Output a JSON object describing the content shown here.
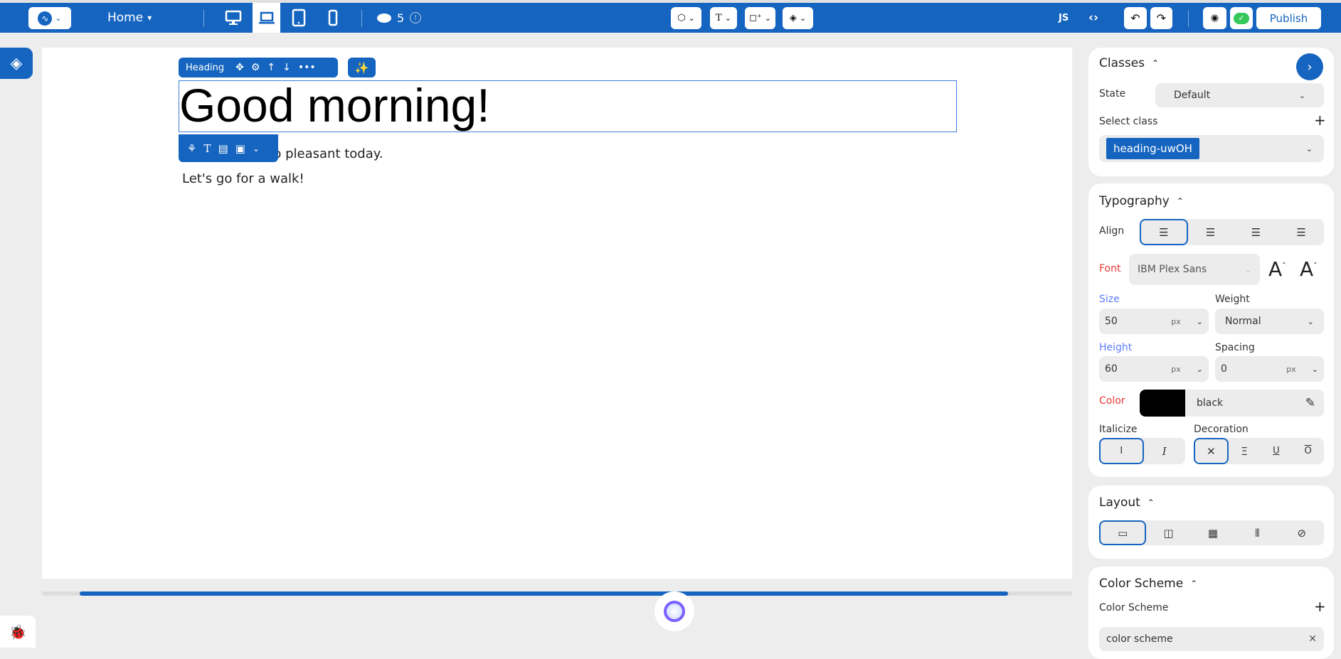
{
  "colors": {
    "brand": "#1565c0",
    "background": "#ededed",
    "label_red": "#e53935",
    "label_blue": "#5c7cfa",
    "text_color_swatch": "#000000"
  },
  "topbar": {
    "page_select": "Home",
    "devices": [
      "desktop-icon",
      "laptop-icon",
      "tablet-icon",
      "mobile-icon"
    ],
    "active_device": "laptop",
    "credits": "5",
    "js_label": "JS",
    "publish_label": "Publish"
  },
  "canvas": {
    "element_toolbar_label": "Heading",
    "heading": "Good morning!",
    "paragraph_visible": "so pleasant today.",
    "paragraph2": "Let's go for a walk!",
    "scroll_fraction": 0.9
  },
  "panel": {
    "classes": {
      "title": "Classes",
      "state_label": "State",
      "state_value": "Default",
      "select_class_label": "Select class",
      "selected_class": "heading-uwOH"
    },
    "typography": {
      "title": "Typography",
      "align_label": "Align",
      "align_active": "left",
      "font_label": "Font",
      "font_value": "IBM Plex Sans",
      "size_label": "Size",
      "size_value": "50",
      "size_unit": "px",
      "weight_label": "Weight",
      "weight_value": "Normal",
      "height_label": "Height",
      "height_value": "60",
      "height_unit": "px",
      "spacing_label": "Spacing",
      "spacing_value": "0",
      "spacing_unit": "px",
      "color_label": "Color",
      "color_value": "black",
      "italicize_label": "Italicize",
      "decoration_label": "Decoration"
    },
    "layout": {
      "title": "Layout"
    },
    "color_scheme": {
      "title": "Color Scheme",
      "label": "Color Scheme",
      "value": "color scheme"
    }
  }
}
